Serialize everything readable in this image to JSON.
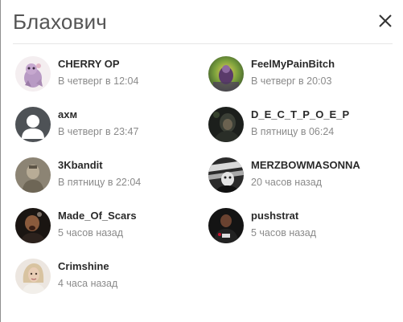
{
  "dialog": {
    "title": "Блахович"
  },
  "users": [
    {
      "name": "CHERRY OP",
      "time": "В четверг в 12:04",
      "avatar": "cherry-avatar"
    },
    {
      "name": "FeelMyPainBitch",
      "time": "В четверг в 20:03",
      "avatar": "feel-avatar"
    },
    {
      "name": "axм",
      "time": "В четверг в 23:47",
      "avatar": "default-avatar"
    },
    {
      "name": "D_E_C_T_P_O_E_P",
      "time": "В пятницу в 06:24",
      "avatar": "dect-avatar"
    },
    {
      "name": "3Kbandit",
      "time": "В пятницу в 22:04",
      "avatar": "bandit-avatar"
    },
    {
      "name": "MERZBOWMASONNA",
      "time": "20 часов назад",
      "avatar": "merz-avatar"
    },
    {
      "name": "Made_Of_Scars",
      "time": "5 часов назад",
      "avatar": "scars-avatar"
    },
    {
      "name": "pushstrat",
      "time": "5 часов назад",
      "avatar": "push-avatar"
    },
    {
      "name": "Crimshine",
      "time": "4 часа назад",
      "avatar": "crim-avatar"
    }
  ]
}
